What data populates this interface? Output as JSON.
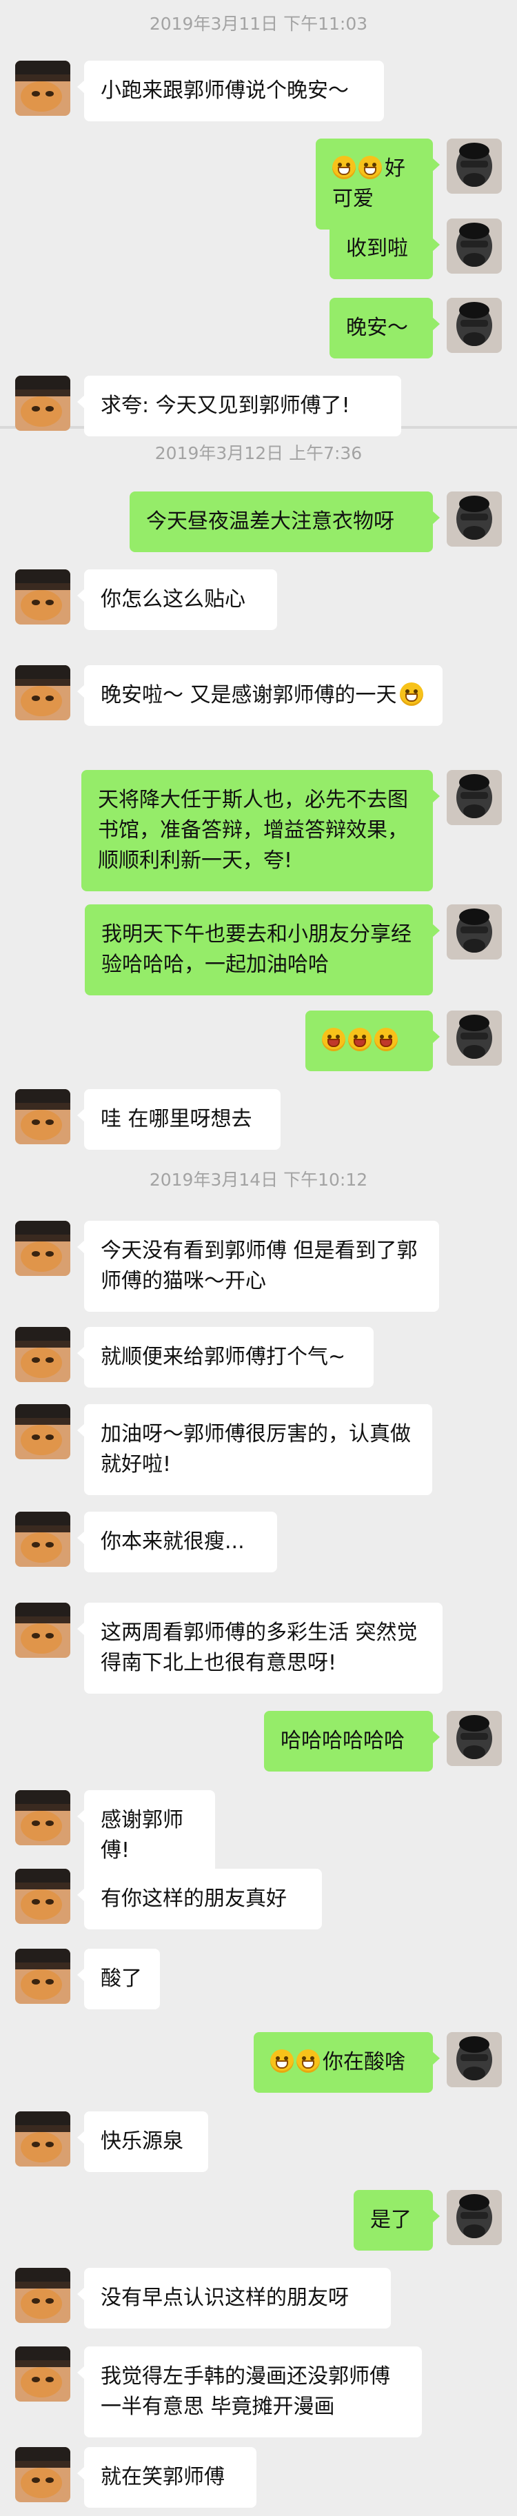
{
  "colors": {
    "background": "#ededed",
    "incoming_bubble": "#ffffff",
    "outgoing_bubble": "#95ec69",
    "timestamp": "#a3a3a3"
  },
  "timestamps": [
    "2019年3月11日 下午11:03",
    "2019年3月12日 上午7:36",
    "2019年3月14日 下午10:12"
  ],
  "messages": [
    {
      "dir": "in",
      "text": "小跑来跟郭师傅说个晚安～"
    },
    {
      "dir": "out",
      "emoji": [
        "grin-icon",
        "grin-icon"
      ],
      "text": "好可爱"
    },
    {
      "dir": "out",
      "text": "收到啦"
    },
    {
      "dir": "out",
      "text": "晚安～"
    },
    {
      "dir": "in",
      "text": "求夸: 今天又见到郭师傅了!"
    },
    {
      "dir": "out",
      "text": "今天昼夜温差大注意衣物呀"
    },
    {
      "dir": "in",
      "text": "你怎么这么贴心"
    },
    {
      "dir": "in",
      "text": "晚安啦～ 又是感谢郭师傅的一天",
      "emoji_after": [
        "smile-icon"
      ]
    },
    {
      "dir": "out",
      "text": "天将降大任于斯人也，必先不去图书馆，准备答辩，增益答辩效果，顺顺利利新一天，夸!"
    },
    {
      "dir": "out",
      "text": "我明天下午也要去和小朋友分享经验哈哈哈，一起加油哈哈"
    },
    {
      "dir": "out",
      "emoji": [
        "tongue-icon",
        "tongue-icon",
        "tongue-icon"
      ],
      "text": ""
    },
    {
      "dir": "in",
      "text": "哇 在哪里呀想去"
    },
    {
      "dir": "in",
      "text": "今天没有看到郭师傅 但是看到了郭师傅的猫咪～开心"
    },
    {
      "dir": "in",
      "text": "就顺便来给郭师傅打个气~"
    },
    {
      "dir": "in",
      "text": "加油呀～郭师傅很厉害的，认真做就好啦!"
    },
    {
      "dir": "in",
      "text": "你本来就很瘦..."
    },
    {
      "dir": "in",
      "text": "这两周看郭师傅的多彩生活 突然觉得南下北上也很有意思呀!"
    },
    {
      "dir": "out",
      "text": "哈哈哈哈哈哈"
    },
    {
      "dir": "in",
      "text": "感谢郭师傅!"
    },
    {
      "dir": "in",
      "text": "有你这样的朋友真好"
    },
    {
      "dir": "in",
      "text": "酸了"
    },
    {
      "dir": "out",
      "emoji": [
        "grin-icon",
        "grin-icon"
      ],
      "text": "你在酸啥"
    },
    {
      "dir": "in",
      "text": "快乐源泉"
    },
    {
      "dir": "out",
      "text": "是了"
    },
    {
      "dir": "in",
      "text": "没有早点认识这样的朋友呀"
    },
    {
      "dir": "in",
      "text": "我觉得左手韩的漫画还没郭师傅一半有意思 毕竟摊开漫画"
    },
    {
      "dir": "in",
      "text": "就在笑郭师傅"
    }
  ]
}
